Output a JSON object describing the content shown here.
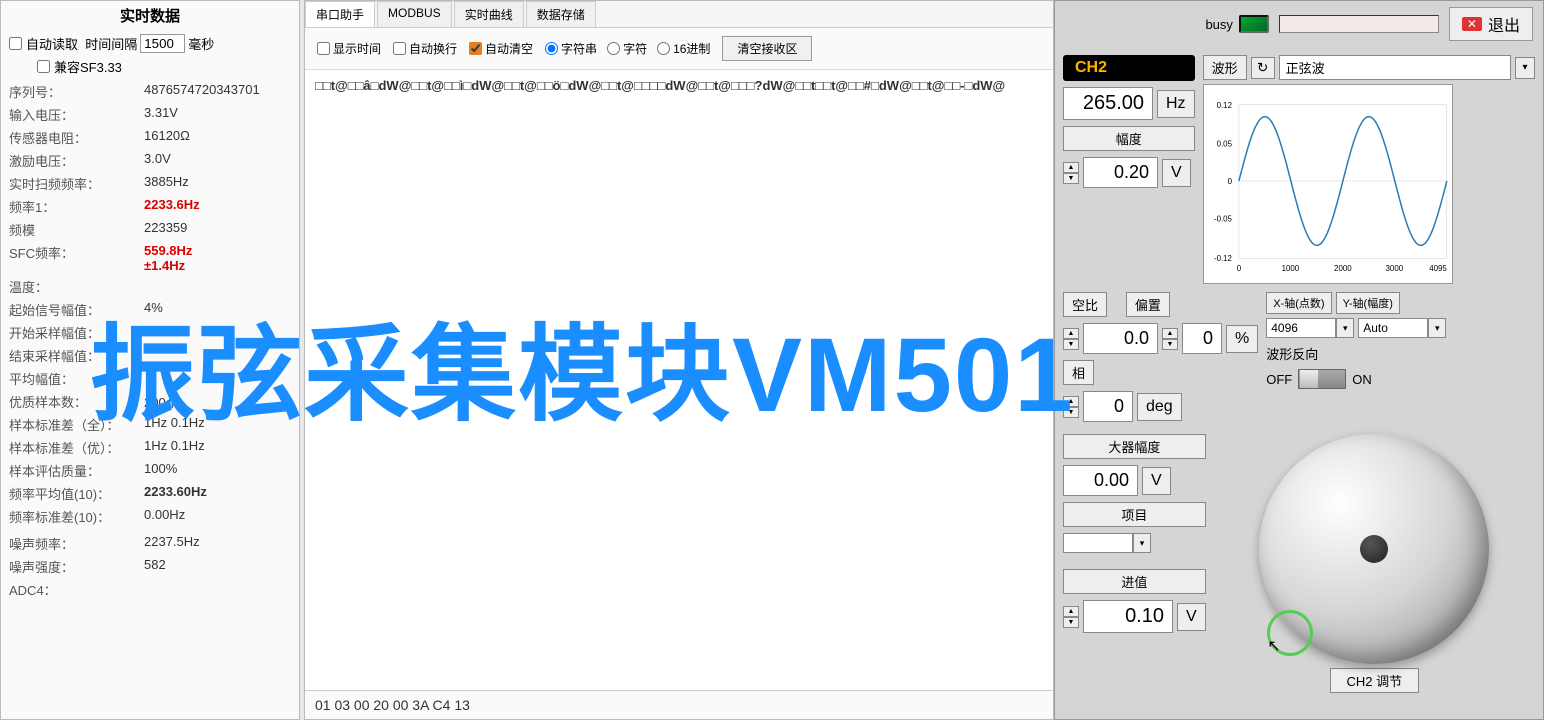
{
  "watermark": "振弦采集模块VM501",
  "left": {
    "title": "实时数据",
    "auto_read": "自动读取",
    "interval_label": "时间间隔",
    "interval": "1500",
    "interval_unit": "毫秒",
    "compat": "兼容SF3.33",
    "rows": [
      {
        "lbl": "序列号：",
        "val": "4876574720343701"
      },
      {
        "lbl": "输入电压：",
        "val": "3.31V"
      },
      {
        "lbl": "传感器电阻：",
        "val": "16120Ω"
      },
      {
        "lbl": "激励电压：",
        "val": "3.0V"
      },
      {
        "lbl": "实时扫频频率：",
        "val": "3885Hz"
      },
      {
        "lbl": "频率1：",
        "val": "2233.6Hz",
        "cls": "red"
      },
      {
        "lbl": "频模",
        "val": "223359"
      },
      {
        "lbl": "SFC频率：",
        "val": "559.8Hz\n±1.4Hz",
        "cls": "red"
      },
      {
        "lbl": "温度：",
        "val": ""
      },
      {
        "lbl": "起始信号幅值：",
        "val": "4%"
      },
      {
        "lbl": "开始采样幅值：",
        "val": ""
      },
      {
        "lbl": "结束采样幅值：",
        "val": ""
      },
      {
        "lbl": "平均幅值：",
        "val": ""
      },
      {
        "lbl": "优质样本数：",
        "val": "200个"
      },
      {
        "lbl": "样本标准差（全）：",
        "val": "1Hz 0.1Hz"
      },
      {
        "lbl": "样本标准差（优）：",
        "val": "1Hz 0.1Hz"
      },
      {
        "lbl": "样本评估质量：",
        "val": "100%"
      },
      {
        "lbl": "频率平均值(10)：",
        "val": "2233.60Hz",
        "cls": "bold"
      },
      {
        "lbl": "频率标准差(10)：",
        "val": "0.00Hz"
      },
      {
        "lbl": "",
        "val": ""
      },
      {
        "lbl": "噪声频率：",
        "val": "2237.5Hz"
      },
      {
        "lbl": "噪声强度：",
        "val": "582"
      },
      {
        "lbl": "ADC4：",
        "val": ""
      }
    ]
  },
  "mid": {
    "tabs": [
      "串口助手",
      "MODBUS",
      "实时曲线",
      "数据存储"
    ],
    "show_time": "显示时间",
    "auto_wrap": "自动换行",
    "auto_clear": "自动清空",
    "fmt_str": "字符串",
    "fmt_char": "字符",
    "fmt_hex": "16进制",
    "clear_btn": "清空接收区",
    "recv": "□□t@□□â□dW@□□t@□□ì□dW@□□t@□□ö□dW@□□t@□□□□dW@□□t@□□□?dW@□□t□□t@□□#□dW@□□t@□□-□dW@",
    "send": "01 03 00 20 00 3A C4 13"
  },
  "right": {
    "busy": "busy",
    "exit": "退出",
    "ch": "CH2",
    "wave_btn": "波形",
    "wave_sel": "正弦波",
    "freq": "265.00",
    "freq_unit": "Hz",
    "amp_lbl": "幅度",
    "amp": "0.20",
    "amp_unit": "V",
    "duty_lbl": "空比",
    "offset_btn": "偏置",
    "duty": "0.0",
    "duty_unit": "%",
    "phase_lbl": "相",
    "phase": "0",
    "phase_unit": "deg",
    "xaxis": "X-轴(点数)",
    "yaxis": "Y-轴(幅度)",
    "xval": "4096",
    "yval": "Auto",
    "invert_lbl": "波形反向",
    "off": "OFF",
    "on": "ON",
    "ampamp_lbl": "大器幅度",
    "ampamp": "0.00",
    "ampamp_unit": "V",
    "proj_lbl": "项目",
    "step_lbl": "进值",
    "step": "0.10",
    "step_unit": "V",
    "dial_lbl": "CH2 调节"
  },
  "chart_data": {
    "type": "line",
    "title": "",
    "xlabel": "",
    "ylabel": "",
    "xlim": [
      0,
      4095
    ],
    "ylim": [
      -0.12,
      0.12
    ],
    "yticks": [
      -0.12,
      -0.05,
      0,
      0.05,
      0.12
    ],
    "xticks": [
      0,
      1000,
      2000,
      3000,
      4095
    ],
    "series": [
      {
        "name": "sine",
        "amp": 0.1,
        "periods": 2
      }
    ]
  }
}
